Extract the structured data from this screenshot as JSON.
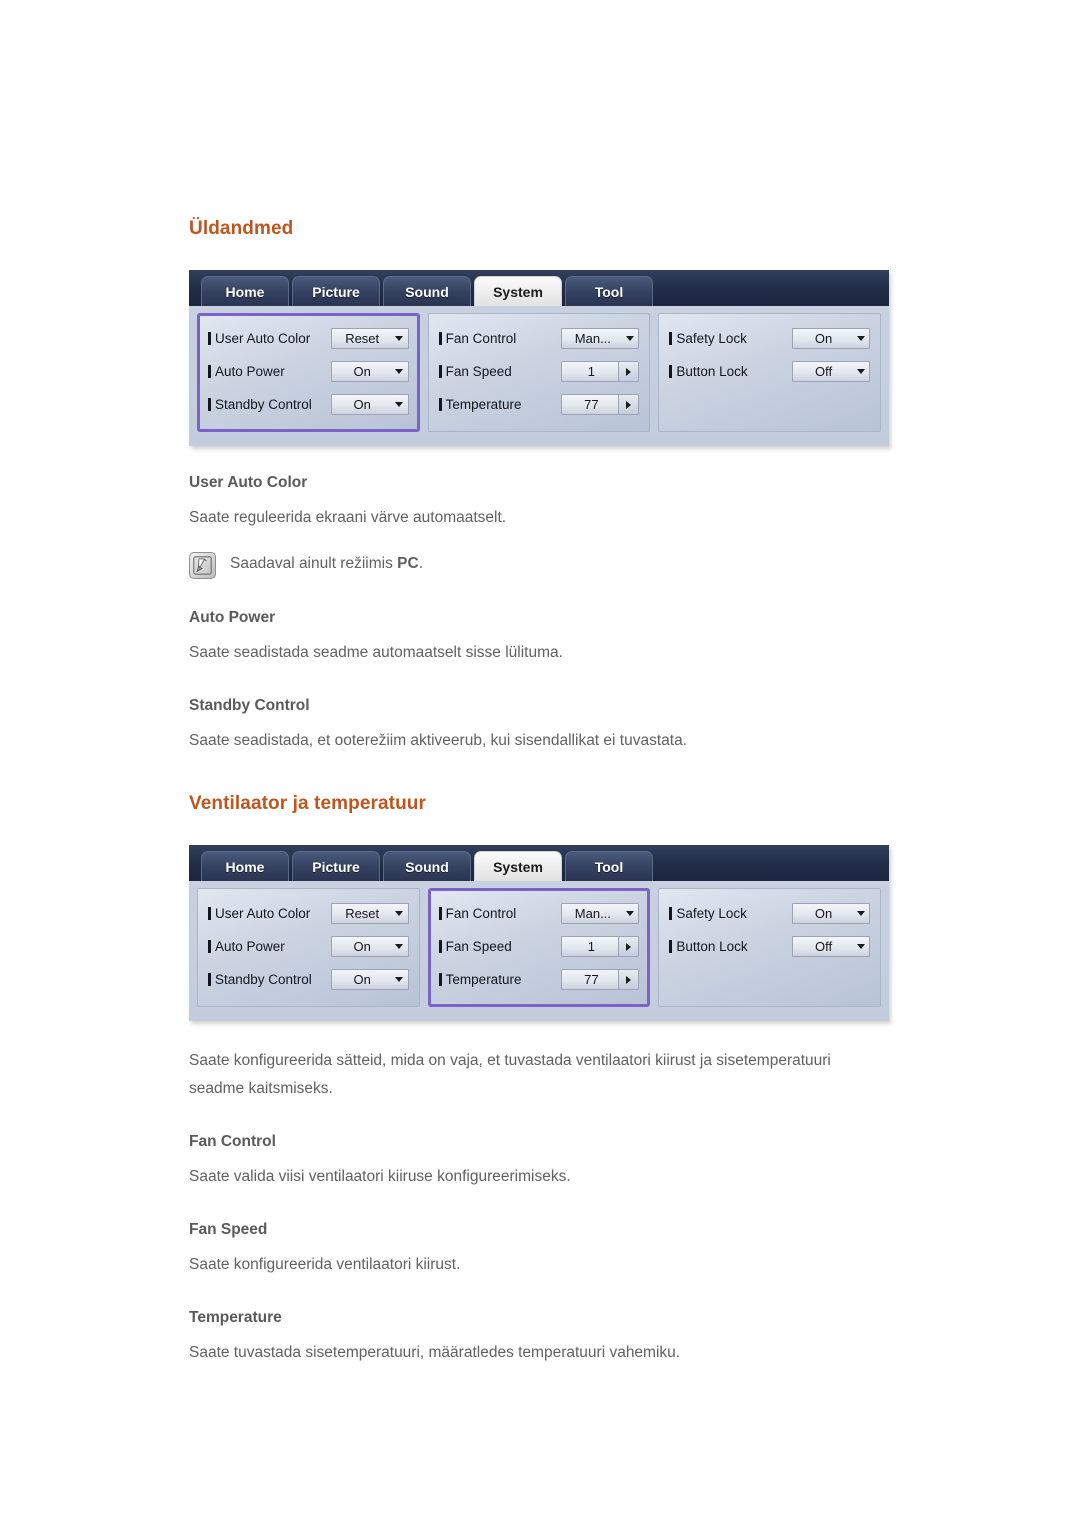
{
  "page": {
    "sections": [
      {
        "heading": "Üldandmed",
        "osd_id": "osd_general",
        "blocks": [
          {
            "type": "subheading",
            "text": "User Auto Color"
          },
          {
            "type": "paragraph",
            "text": "Saate reguleerida ekraani värve automaatselt."
          },
          {
            "type": "note",
            "icon": "note-pen-icon",
            "text_before": "Saadaval ainult režiimis ",
            "text_bold": "PC",
            "text_after": "."
          },
          {
            "type": "subheading",
            "text": "Auto Power"
          },
          {
            "type": "paragraph",
            "text": "Saate seadistada seadme automaatselt sisse lülituma."
          },
          {
            "type": "subheading",
            "text": "Standby Control"
          },
          {
            "type": "paragraph",
            "text": "Saate seadistada, et ooterežiim aktiveerub, kui sisendallikat ei tuvastata."
          }
        ]
      },
      {
        "heading": "Ventilaator ja temperatuur",
        "osd_id": "osd_fan",
        "blocks": [
          {
            "type": "paragraph",
            "text": "Saate konfigureerida sätteid, mida on vaja, et tuvastada ventilaatori kiirust ja sisetemperatuuri seadme kaitsmiseks."
          },
          {
            "type": "subheading",
            "text": "Fan Control"
          },
          {
            "type": "paragraph",
            "text": "Saate valida viisi ventilaatori kiiruse konfigureerimiseks."
          },
          {
            "type": "subheading",
            "text": "Fan Speed"
          },
          {
            "type": "paragraph",
            "text": "Saate konfigureerida ventilaatori kiirust."
          },
          {
            "type": "subheading",
            "text": "Temperature"
          },
          {
            "type": "paragraph",
            "text": "Saate tuvastada sisetemperatuuri, määratledes temperatuuri vahemiku."
          }
        ]
      }
    ]
  },
  "colors": {
    "heading_orange": "#c0551f",
    "subheading_gray": "#5a5a5a",
    "body_gray": "#616161",
    "osd_tabbar_navy": "#222e49",
    "osd_panel_blue": "#c3ccdd",
    "highlight_purple": "#7b62c8"
  },
  "osd_general": {
    "tabs": [
      {
        "label": "Home",
        "active": false
      },
      {
        "label": "Picture",
        "active": false
      },
      {
        "label": "Sound",
        "active": false
      },
      {
        "label": "System",
        "active": true
      },
      {
        "label": "Tool",
        "active": false
      }
    ],
    "columns": [
      {
        "highlighted": true,
        "rows": [
          {
            "label": "User Auto Color",
            "value": "Reset",
            "control": "dropdown"
          },
          {
            "label": "Auto Power",
            "value": "On",
            "control": "dropdown"
          },
          {
            "label": "Standby Control",
            "value": "On",
            "control": "dropdown"
          }
        ]
      },
      {
        "highlighted": false,
        "rows": [
          {
            "label": "Fan Control",
            "value": "Man...",
            "control": "dropdown"
          },
          {
            "label": "Fan Speed",
            "value": "1",
            "control": "stepper"
          },
          {
            "label": "Temperature",
            "value": "77",
            "control": "stepper"
          }
        ]
      },
      {
        "highlighted": false,
        "rows": [
          {
            "label": "Safety Lock",
            "value": "On",
            "control": "dropdown"
          },
          {
            "label": "Button Lock",
            "value": "Off",
            "control": "dropdown"
          }
        ]
      }
    ]
  },
  "osd_fan": {
    "tabs": [
      {
        "label": "Home",
        "active": false
      },
      {
        "label": "Picture",
        "active": false
      },
      {
        "label": "Sound",
        "active": false
      },
      {
        "label": "System",
        "active": true
      },
      {
        "label": "Tool",
        "active": false
      }
    ],
    "columns": [
      {
        "highlighted": false,
        "rows": [
          {
            "label": "User Auto Color",
            "value": "Reset",
            "control": "dropdown"
          },
          {
            "label": "Auto Power",
            "value": "On",
            "control": "dropdown"
          },
          {
            "label": "Standby Control",
            "value": "On",
            "control": "dropdown"
          }
        ]
      },
      {
        "highlighted": true,
        "rows": [
          {
            "label": "Fan Control",
            "value": "Man...",
            "control": "dropdown"
          },
          {
            "label": "Fan Speed",
            "value": "1",
            "control": "stepper"
          },
          {
            "label": "Temperature",
            "value": "77",
            "control": "stepper"
          }
        ]
      },
      {
        "highlighted": false,
        "rows": [
          {
            "label": "Safety Lock",
            "value": "On",
            "control": "dropdown"
          },
          {
            "label": "Button Lock",
            "value": "Off",
            "control": "dropdown"
          }
        ]
      }
    ]
  }
}
